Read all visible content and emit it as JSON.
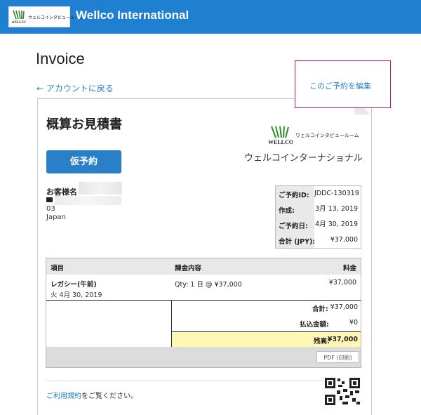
{
  "header": {
    "brand_logo_text": "WELLCO",
    "brand_logo_subtext": "ウェルコインタビュールーム",
    "app_title": "Wellco International"
  },
  "page": {
    "title": "Invoice",
    "back_link": "← アカウントに戻る",
    "edit_link": "このご予約を編集"
  },
  "document": {
    "title": "概算お見積書",
    "status_button": "仮予約",
    "company_logo_subtext": "ウェルコインタビュールーム",
    "company_name": "ウェルコインターナショナル",
    "customer": {
      "label": "お客様名",
      "address_line1": "03",
      "address_line2": "Japan"
    },
    "info": [
      {
        "key": "ご予約ID:",
        "value": "JDDC-130319"
      },
      {
        "key": "作成:",
        "value": "3月 13, 2019"
      },
      {
        "key": "ご予約日:",
        "value": "4月 30, 2019"
      },
      {
        "key": "合計 (JPY):",
        "value": "¥37,000"
      }
    ],
    "table": {
      "headers": {
        "item": "項目",
        "details": "課金内容",
        "price": "料金"
      },
      "rows": [
        {
          "name": "レガシー(午前)",
          "date": "火 4月 30, 2019",
          "qty": "Qty: 1 日 @ ¥37,000",
          "amount": "¥37,000"
        }
      ],
      "totals": {
        "total_label": "合計:",
        "total_value": "¥37,000",
        "paid_label": "払込金額:",
        "paid_value": "¥0",
        "balance_label": "残高:",
        "balance_value": "¥37,000"
      }
    },
    "pdf_button": "PDF (印刷)",
    "terms": {
      "link": "ご利用規約",
      "rest": "をご覧ください。"
    }
  },
  "colors": {
    "header_bg": "#1f7fd1",
    "link": "#2a7fc9",
    "balance_bg": "#fff7b3",
    "popup_border": "#c0157b"
  }
}
